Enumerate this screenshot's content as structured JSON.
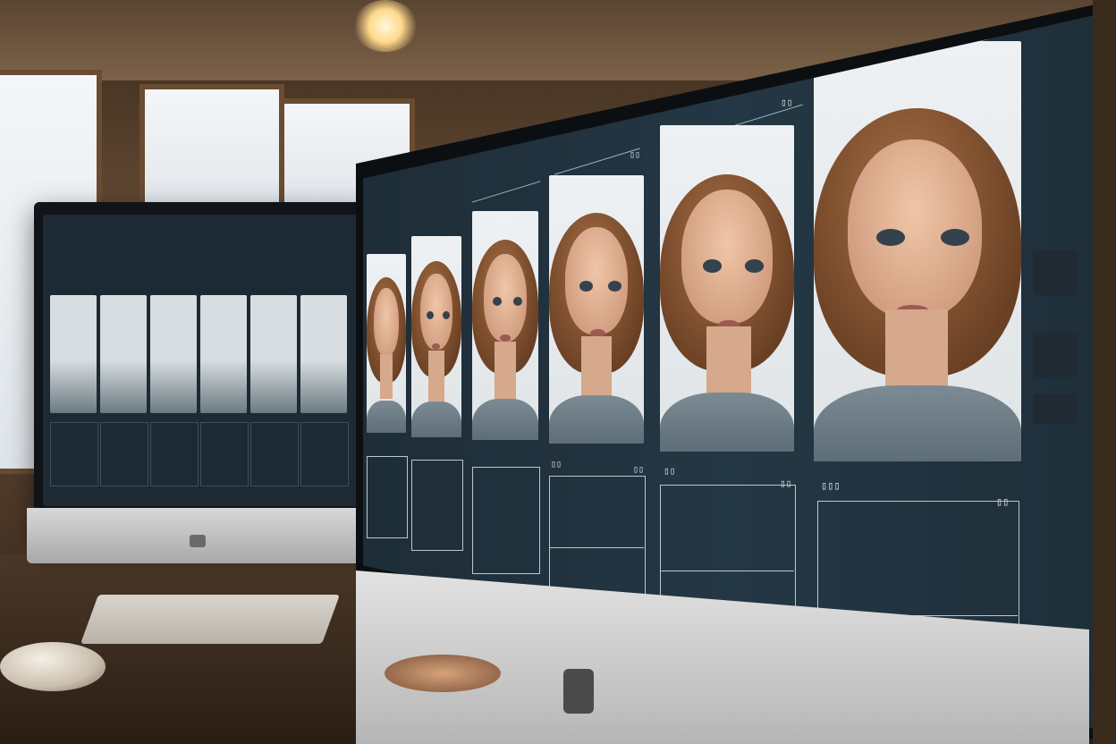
{
  "scene": {
    "colors": {
      "screen_bg": "#243744",
      "ui_text": "#e8eef2",
      "card_bg": "#eef1f3",
      "shirt": "#6e7e88",
      "hair": "#8a5533"
    }
  },
  "left_monitor": {
    "thumbnails": [
      1,
      2,
      3,
      4,
      5,
      6
    ]
  },
  "main_monitor": {
    "panel_labels": [
      "",
      "",
      "",
      "",
      "",
      ""
    ],
    "column_ids": [
      "",
      "",
      "",
      "",
      "",
      ""
    ]
  }
}
